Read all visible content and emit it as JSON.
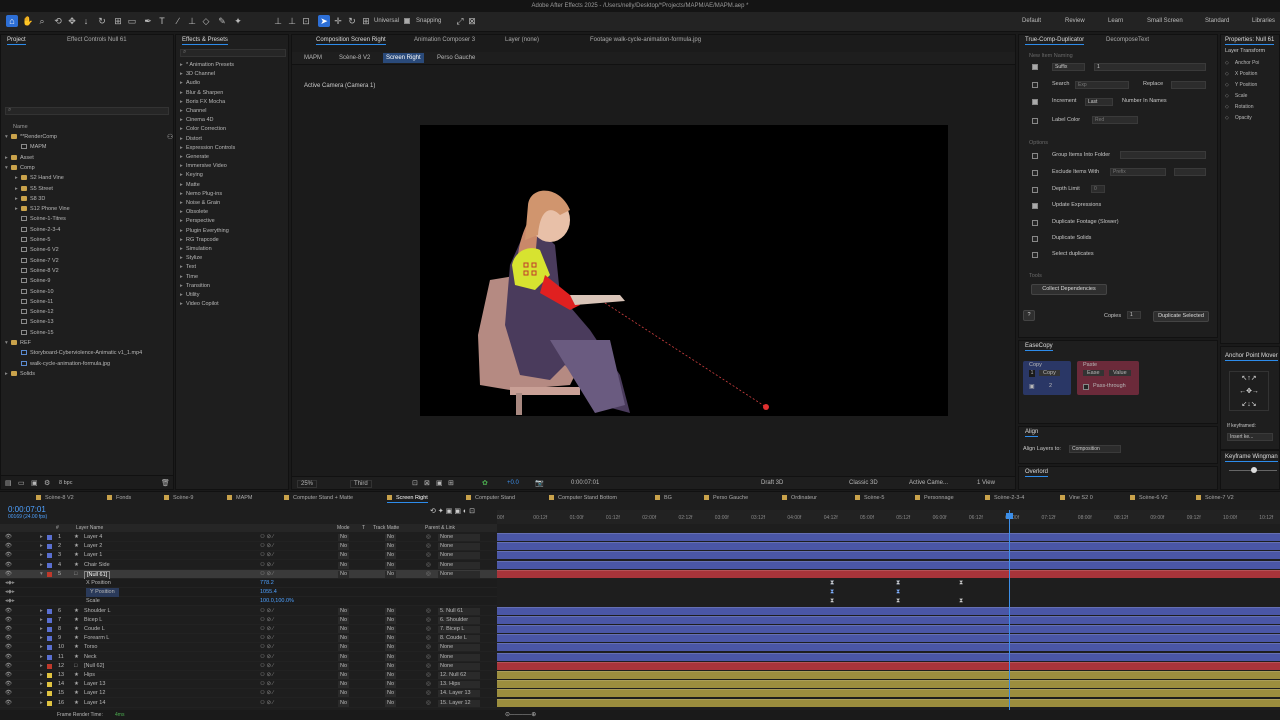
{
  "app_title": "Adobe After Effects 2025 - /Users/nelly/Desktop/*Projects/MAPM/AE/MAPM.aep *",
  "toolbar": {
    "universal": "Universal",
    "snapping": "Snapping"
  },
  "workspaces": [
    "Default",
    "Review",
    "Learn",
    "Small Screen",
    "Standard",
    "Libraries"
  ],
  "project": {
    "tabs": [
      "Project",
      "Effect Controls Null 61"
    ],
    "column_name": "Name",
    "items": [
      {
        "label": "**RenderComp",
        "indent": 0,
        "type": "folder",
        "open": true
      },
      {
        "label": "MAPM",
        "indent": 1,
        "type": "comp"
      },
      {
        "label": "Asset",
        "indent": 0,
        "type": "folder"
      },
      {
        "label": "Comp",
        "indent": 0,
        "type": "folder",
        "open": true
      },
      {
        "label": "S2 Hand Vine",
        "indent": 1,
        "type": "folder"
      },
      {
        "label": "S5 Street",
        "indent": 1,
        "type": "folder"
      },
      {
        "label": "S8 3D",
        "indent": 1,
        "type": "folder"
      },
      {
        "label": "S12 Phone Vine",
        "indent": 1,
        "type": "folder"
      },
      {
        "label": "Scène-1-Titres",
        "indent": 1,
        "type": "comp"
      },
      {
        "label": "Scène-2-3-4",
        "indent": 1,
        "type": "comp"
      },
      {
        "label": "Scène-5",
        "indent": 1,
        "type": "comp"
      },
      {
        "label": "Scène-6 V2",
        "indent": 1,
        "type": "comp"
      },
      {
        "label": "Scène-7 V2",
        "indent": 1,
        "type": "comp"
      },
      {
        "label": "Scène-8 V2",
        "indent": 1,
        "type": "comp"
      },
      {
        "label": "Scène-9",
        "indent": 1,
        "type": "comp"
      },
      {
        "label": "Scène-10",
        "indent": 1,
        "type": "comp"
      },
      {
        "label": "Scène-11",
        "indent": 1,
        "type": "comp"
      },
      {
        "label": "Scène-12",
        "indent": 1,
        "type": "comp"
      },
      {
        "label": "Scène-13",
        "indent": 1,
        "type": "comp"
      },
      {
        "label": "Scène-15",
        "indent": 1,
        "type": "comp"
      },
      {
        "label": "REF",
        "indent": 0,
        "type": "folder",
        "open": true
      },
      {
        "label": "Storyboard-Cyberviolence-Animatic v1_1.mp4",
        "indent": 1,
        "type": "file"
      },
      {
        "label": "walk-cycle-animation-formula.jpg",
        "indent": 1,
        "type": "file"
      },
      {
        "label": "Solids",
        "indent": 0,
        "type": "folder"
      }
    ],
    "bpc": "8 bpc"
  },
  "effects": {
    "tab": "Effects & Presets",
    "items": [
      "* Animation Presets",
      "3D Channel",
      "Audio",
      "Blur & Sharpen",
      "Boris FX Mocha",
      "Channel",
      "Cinema 4D",
      "Color Correction",
      "Distort",
      "Expression Controls",
      "Generate",
      "Immersive Video",
      "Keying",
      "Matte",
      "Nemo Plug-ins",
      "Noise & Grain",
      "Obsolete",
      "Perspective",
      "Plugin Everything",
      "RG Trapcode",
      "Simulation",
      "Stylize",
      "Text",
      "Time",
      "Transition",
      "Utility",
      "Video Copilot"
    ]
  },
  "viewer": {
    "tabs": [
      "Composition Screen Right",
      "Animation Composer 3",
      "Layer (none)",
      "Footage walk-cycle-animation-formula.jpg"
    ],
    "breadcrumbs": [
      "MAPM",
      "Scène-8 V2",
      "Screen Right",
      "Perso Gauche"
    ],
    "camera_label": "Active Camera (Camera 1)",
    "zoom": "25%",
    "resolution": "Third",
    "exposure": "+0.0",
    "timecode": "0:00:07:01",
    "renderer_mode": "Draft 3D",
    "renderer": "Classic 3D",
    "camera": "Active Came...",
    "views": "1 View"
  },
  "tcd": {
    "tabs": [
      "True-Comp-Duplicator",
      "DecomposeText"
    ],
    "section1": "New Item Naming",
    "suffix": "Suffix",
    "suffix_val": "1",
    "search": "Search",
    "search_ph": "Exp",
    "replace": "Replace",
    "increment": "Increment",
    "increment_mode": "Last",
    "in_names": "Number In Names",
    "label_color": "Label Color",
    "label_color_val": "Red",
    "options": "Options",
    "group": "Group Items Into Folder",
    "exclude": "Exclude Items With",
    "exclude_val": "Prefix",
    "depth": "Depth Limit",
    "depth_val": "0",
    "update": "Update Expressions",
    "dup_footage": "Duplicate Footage (Slower)",
    "dup_solids": "Duplicate Solids",
    "select_dups": "Select duplicates",
    "tools": "Tools",
    "collect": "Collect Dependencies",
    "help": "?",
    "copies": "Copies",
    "copies_val": "1",
    "dup_selected": "Duplicate Selected"
  },
  "easecopy": {
    "title": "EaseCopy",
    "copy_lbl": "Copy",
    "copy_btn": "Copy",
    "copy_num": "1",
    "copy_num2": "2",
    "paste_lbl": "Paste",
    "ease": "Ease",
    "value": "Value",
    "pass": "Pass-through"
  },
  "align": {
    "title": "Align",
    "align_to": "Align Layers to:",
    "target": "Composition"
  },
  "overlord": {
    "title": "Overlord"
  },
  "properties": {
    "title": "Properties: Null 61",
    "section": "Layer Transform",
    "items": [
      "Anchor Poi",
      "X Position",
      "Y Position",
      "Scale",
      "Rotation",
      "Opacity"
    ]
  },
  "anchor": {
    "title": "Anchor Point Mover",
    "if_kf": "If keyframed:",
    "insert": "Insert ke..."
  },
  "wingman": {
    "title": "Keyframe Wingman"
  },
  "timeline": {
    "tabs": [
      "Scène-8 V2",
      "Fonds",
      "Scène-9",
      "MAPM",
      "Computer Stand + Matte",
      "Screen Right",
      "Computer Stand",
      "Computer Stand Bottom",
      "BG",
      "Perso Gauche",
      "Ordinateur",
      "Scène-5",
      "Personnage",
      "Scène-2-3-4",
      "Vine S2 0",
      "Scène-6 V2",
      "Scène-7 V2"
    ],
    "timecode": "0:00:07:01",
    "frames": "00169 (24.00 fps)",
    "col_num": "#",
    "col_name": "Layer Name",
    "col_mode": "Mode",
    "col_t": "T",
    "col_track": "Track Matte",
    "col_parent": "Parent & Link",
    "ticks": [
      "00f",
      "00:12f",
      "01:00f",
      "01:12f",
      "02:00f",
      "02:12f",
      "03:00f",
      "03:12f",
      "04:00f",
      "04:12f",
      "05:00f",
      "05:12f",
      "06:00f",
      "06:12f",
      "07:00f",
      "07:12f",
      "08:00f",
      "08:12f",
      "09:00f",
      "09:12f",
      "10:00f",
      "10:12f"
    ],
    "layers": [
      {
        "num": "1",
        "name": "Layer 4",
        "color": "#5a6fd0",
        "mode": "No",
        "matte": "No",
        "parent": "None"
      },
      {
        "num": "2",
        "name": "Layer 2",
        "color": "#5a6fd0",
        "mode": "No",
        "matte": "No",
        "parent": "None"
      },
      {
        "num": "3",
        "name": "Layer 1",
        "color": "#5a6fd0",
        "mode": "No",
        "matte": "No",
        "parent": "None"
      },
      {
        "num": "4",
        "name": "Chair Side",
        "color": "#5a6fd0",
        "mode": "No",
        "matte": "No",
        "parent": "None"
      },
      {
        "num": "5",
        "name": "[Null 61]",
        "color": "#c0392b",
        "mode": "No",
        "matte": "No",
        "parent": "None",
        "selected": true
      },
      {
        "prop": "X Position",
        "value": "778.2"
      },
      {
        "prop": "Y Position",
        "value": "1055.4"
      },
      {
        "prop": "Scale",
        "value": "100.0,100.0%"
      },
      {
        "num": "6",
        "name": "Shoulder L",
        "color": "#5a6fd0",
        "mode": "No",
        "matte": "No",
        "parent": "5. Null 61"
      },
      {
        "num": "7",
        "name": "Bicep L",
        "color": "#5a6fd0",
        "mode": "No",
        "matte": "No",
        "parent": "6. Shoulder"
      },
      {
        "num": "8",
        "name": "Coude L",
        "color": "#5a6fd0",
        "mode": "No",
        "matte": "No",
        "parent": "7. Bicep L"
      },
      {
        "num": "9",
        "name": "Forearm L",
        "color": "#5a6fd0",
        "mode": "No",
        "matte": "No",
        "parent": "8. Coude L"
      },
      {
        "num": "10",
        "name": "Torso",
        "color": "#5a6fd0",
        "mode": "No",
        "matte": "No",
        "parent": "None"
      },
      {
        "num": "11",
        "name": "Neck",
        "color": "#5a6fd0",
        "mode": "No",
        "matte": "No",
        "parent": "None"
      },
      {
        "num": "12",
        "name": "[Null 62]",
        "color": "#c0392b",
        "mode": "No",
        "matte": "No",
        "parent": "None"
      },
      {
        "num": "13",
        "name": "Hips",
        "color": "#e0c341",
        "mode": "No",
        "matte": "No",
        "parent": "12. Null 62"
      },
      {
        "num": "14",
        "name": "Layer 13",
        "color": "#e0c341",
        "mode": "No",
        "matte": "No",
        "parent": "13. Hips"
      },
      {
        "num": "15",
        "name": "Layer 12",
        "color": "#e0c341",
        "mode": "No",
        "matte": "No",
        "parent": "14. Layer 13"
      },
      {
        "num": "16",
        "name": "Layer 14",
        "color": "#e0c341",
        "mode": "No",
        "matte": "No",
        "parent": "15. Layer 12"
      }
    ],
    "render_time": "Frame Render Time:",
    "render_val": "4ms"
  }
}
